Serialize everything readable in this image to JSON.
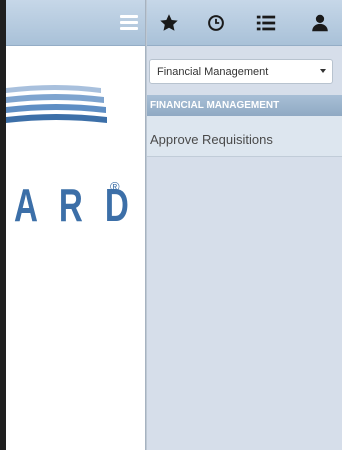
{
  "left_pane": {
    "menu_icon": "hamburger-menu-icon",
    "logo": {
      "text": "A R D",
      "registered_mark": "®",
      "colors": {
        "brand_blue": "#3c6fa8",
        "arc_light": "#a8c0dd",
        "arc_mid": "#5e8ec4",
        "arc_dark": "#3c6fa8"
      }
    }
  },
  "toolbar": {
    "icons": [
      "star-icon",
      "clock-icon",
      "list-icon",
      "user-icon"
    ]
  },
  "module_selector": {
    "value": "Financial Management"
  },
  "section": {
    "header": "FINANCIAL MANAGEMENT",
    "items": [
      {
        "label": "Approve Requisitions"
      }
    ]
  },
  "colors": {
    "toolbar_bg": "#b8cde1",
    "panel_bg": "#d6deea",
    "section_header_bg": "#99b2cb",
    "text_dark": "#4a4a4a"
  }
}
